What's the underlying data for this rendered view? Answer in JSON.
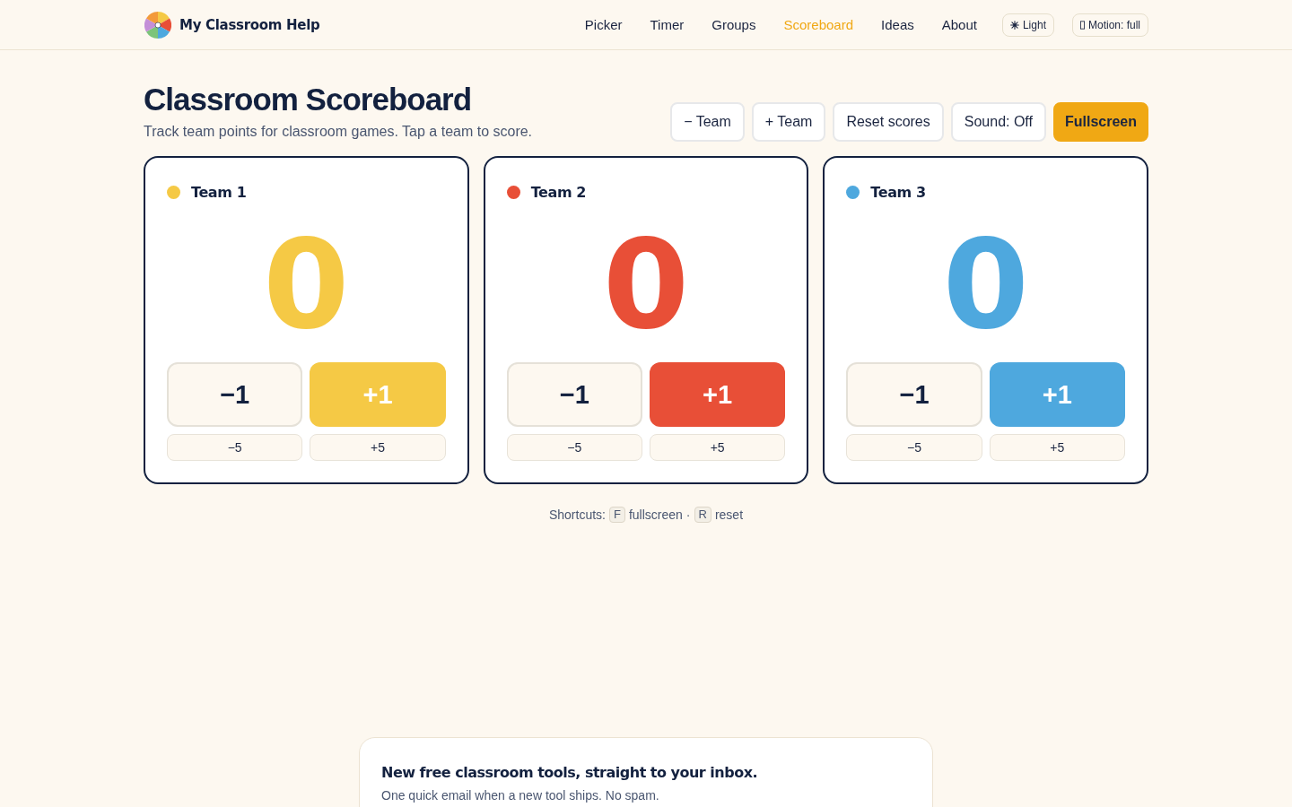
{
  "header": {
    "brand": "My Classroom Help",
    "nav": [
      {
        "label": "Picker",
        "selected": false
      },
      {
        "label": "Timer",
        "selected": false
      },
      {
        "label": "Groups",
        "selected": false
      },
      {
        "label": "Scoreboard",
        "selected": true
      },
      {
        "label": "Ideas",
        "selected": false
      },
      {
        "label": "About",
        "selected": false
      }
    ],
    "theme_button": {
      "label": "Light"
    },
    "motion_button": {
      "label": "Motion: full"
    }
  },
  "page": {
    "title": "Classroom Scoreboard",
    "subtitle": "Track team points for classroom games. Tap a team to score."
  },
  "toolbar": [
    {
      "label": "− Team",
      "kind": "plain"
    },
    {
      "label": "+ Team",
      "kind": "plain"
    },
    {
      "label": "Reset scores",
      "kind": "plain"
    },
    {
      "label": "Sound: Off",
      "kind": "plain"
    },
    {
      "label": "Fullscreen",
      "kind": "primary"
    }
  ],
  "teams": [
    {
      "name": "Team 1",
      "color": "#f5c945",
      "score": "0",
      "big_buttons": [
        "−1",
        "+1"
      ],
      "small_buttons": [
        "−5",
        "+5"
      ]
    },
    {
      "name": "Team 2",
      "color": "#e84f37",
      "score": "0",
      "big_buttons": [
        "−1",
        "+1"
      ],
      "small_buttons": [
        "−5",
        "+5"
      ]
    },
    {
      "name": "Team 3",
      "color": "#4ea8de",
      "score": "0",
      "big_buttons": [
        "−1",
        "+1"
      ],
      "small_buttons": [
        "−5",
        "+5"
      ]
    }
  ],
  "shortcuts": {
    "label": "Shortcuts:",
    "separator": "·",
    "items": [
      {
        "key": "F",
        "action": "fullscreen"
      },
      {
        "key": "R",
        "action": "reset"
      }
    ]
  },
  "newsletter": {
    "title": "New free classroom tools, straight to your inbox.",
    "text": "One quick email when a new tool ships. No spam."
  }
}
